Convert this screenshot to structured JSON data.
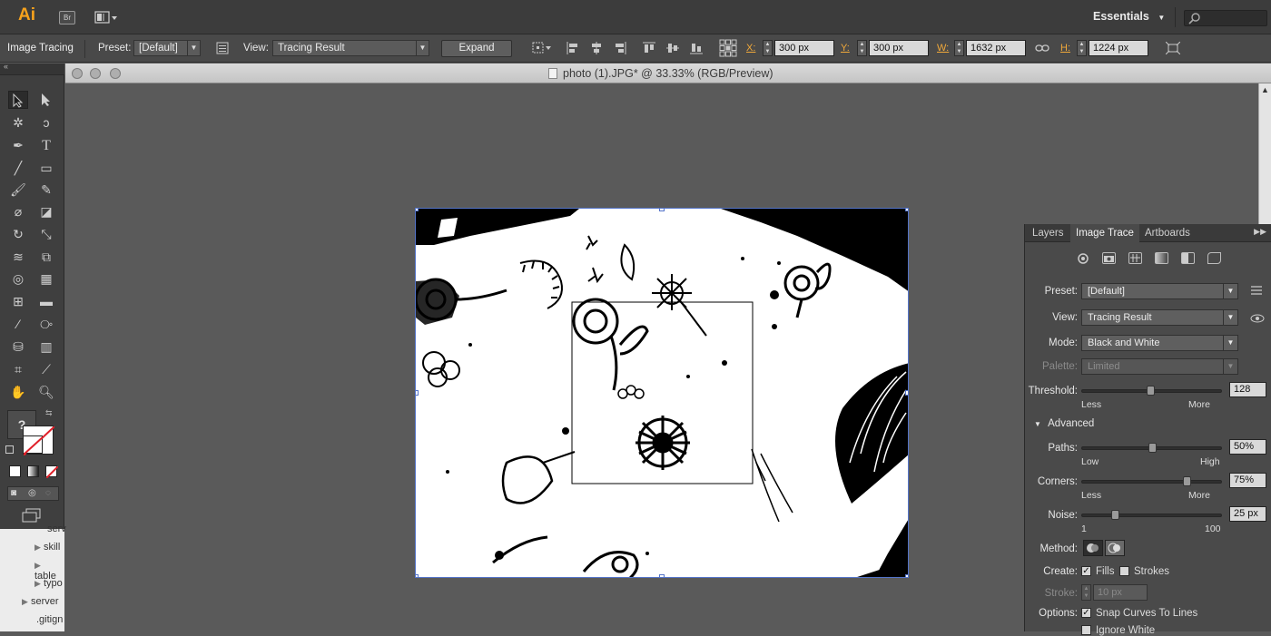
{
  "app": {
    "logo": "Ai",
    "bridge_label": "Br",
    "workspace": "Essentials"
  },
  "control_bar": {
    "mode_label": "Image Tracing",
    "preset_label": "Preset:",
    "preset_value": "[Default]",
    "view_label": "View:",
    "view_value": "Tracing Result",
    "expand_button": "Expand",
    "x_label": "X:",
    "x_value": "300 px",
    "y_label": "Y:",
    "y_value": "300 px",
    "w_label": "W:",
    "w_value": "1632 px",
    "h_label": "H:",
    "h_value": "1224 px"
  },
  "document": {
    "title": "photo (1).JPG* @ 33.33% (RGB/Preview)"
  },
  "tools": {
    "help_glyph": "?"
  },
  "tree": {
    "items": [
      "serv",
      "skill",
      "table",
      "typo",
      "server",
      ".gitign"
    ]
  },
  "image_trace_panel": {
    "tabs": [
      "Layers",
      "Image Trace",
      "Artboards"
    ],
    "active_tab": "Image Trace",
    "preset_label": "Preset:",
    "preset_value": "[Default]",
    "view_label": "View:",
    "view_value": "Tracing Result",
    "mode_label": "Mode:",
    "mode_value": "Black and White",
    "palette_label": "Palette:",
    "palette_value": "Limited",
    "threshold_label": "Threshold:",
    "threshold_value": "128",
    "threshold_level": 0.49,
    "threshold_min": "Less",
    "threshold_max": "More",
    "advanced_label": "Advanced",
    "paths_label": "Paths:",
    "paths_value": "50%",
    "paths_level": 0.5,
    "paths_min": "Low",
    "paths_max": "High",
    "corners_label": "Corners:",
    "corners_value": "75%",
    "corners_level": 0.75,
    "corners_min": "Less",
    "corners_max": "More",
    "noise_label": "Noise:",
    "noise_value": "25 px",
    "noise_level": 0.24,
    "noise_min": "1",
    "noise_max": "100",
    "method_label": "Method:",
    "create_label": "Create:",
    "fills_label": "Fills",
    "fills_checked": true,
    "strokes_label": "Strokes",
    "strokes_checked": false,
    "stroke_label": "Stroke:",
    "stroke_value": "10 px",
    "options_label": "Options:",
    "snap_label": "Snap Curves To Lines",
    "snap_checked": true,
    "ignore_white_label": "Ignore White"
  }
}
